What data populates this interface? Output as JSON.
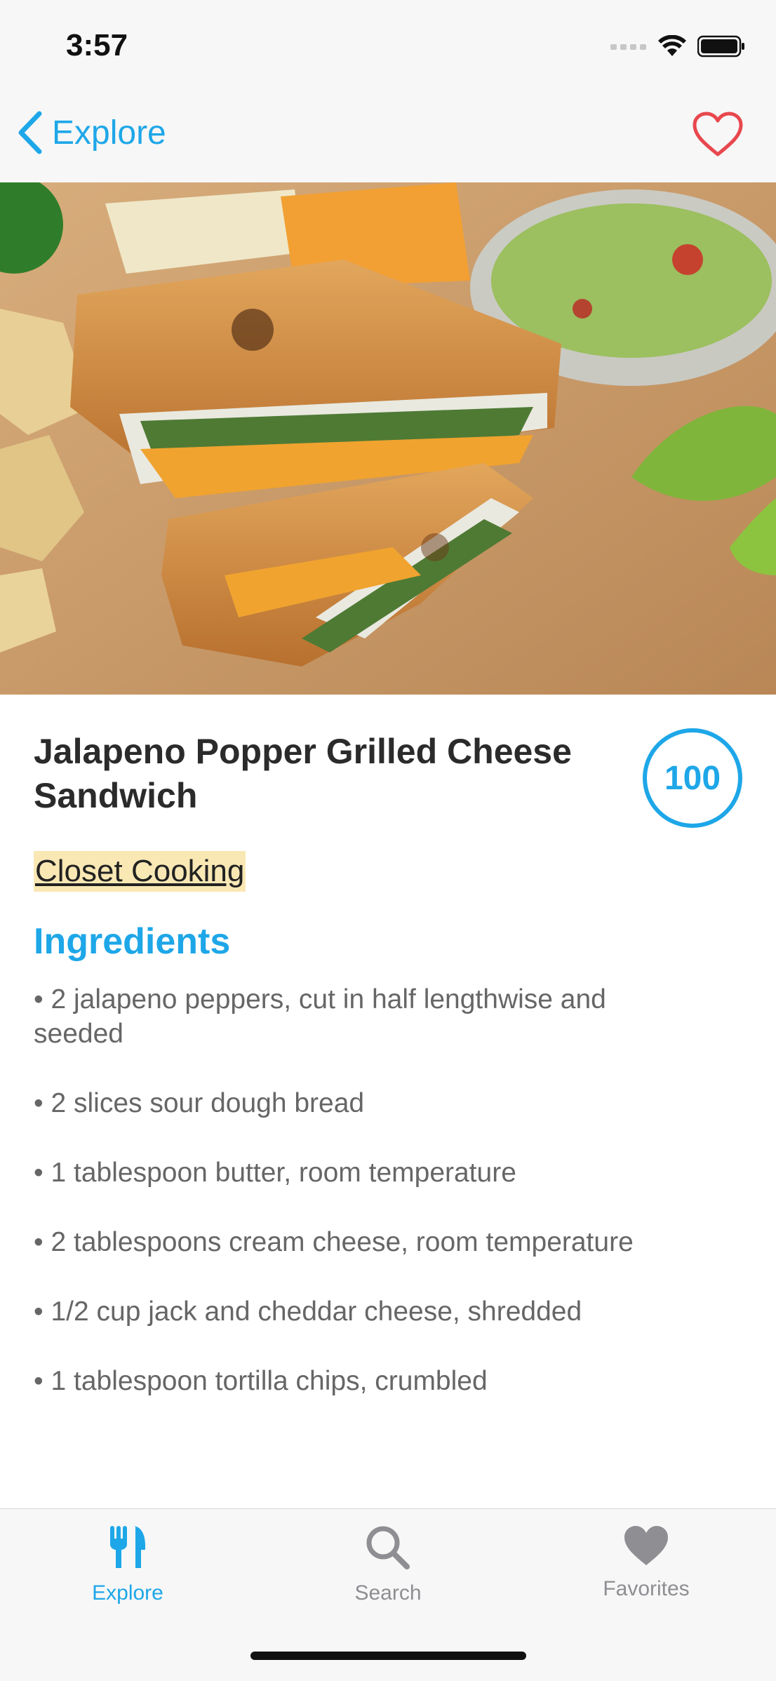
{
  "status_bar": {
    "time": "3:57"
  },
  "nav": {
    "back_label": "Explore",
    "favorite_icon": "heart-outline-icon"
  },
  "recipe": {
    "title": "Jalapeno Popper Grilled Cheese Sandwich",
    "score": "100",
    "source": "Closet Cooking",
    "ingredients_heading": "Ingredients",
    "ingredients": [
      "• 2 jalapeno peppers, cut in half lengthwise and seeded",
      "• 2 slices sour dough bread",
      "• 1 tablespoon butter, room temperature",
      "• 2 tablespoons cream cheese, room temperature",
      "• 1/2 cup jack and cheddar cheese, shredded",
      "• 1 tablespoon tortilla chips, crumbled"
    ]
  },
  "tabs": [
    {
      "label": "Explore",
      "icon": "fork-knife-icon",
      "active": true
    },
    {
      "label": "Search",
      "icon": "search-icon",
      "active": false
    },
    {
      "label": "Favorites",
      "icon": "heart-icon",
      "active": false
    }
  ],
  "colors": {
    "accent": "#1ea7e8",
    "favorite": "#e8474e",
    "inactive": "#8e8e93",
    "source_highlight": "#f9e8b4"
  }
}
